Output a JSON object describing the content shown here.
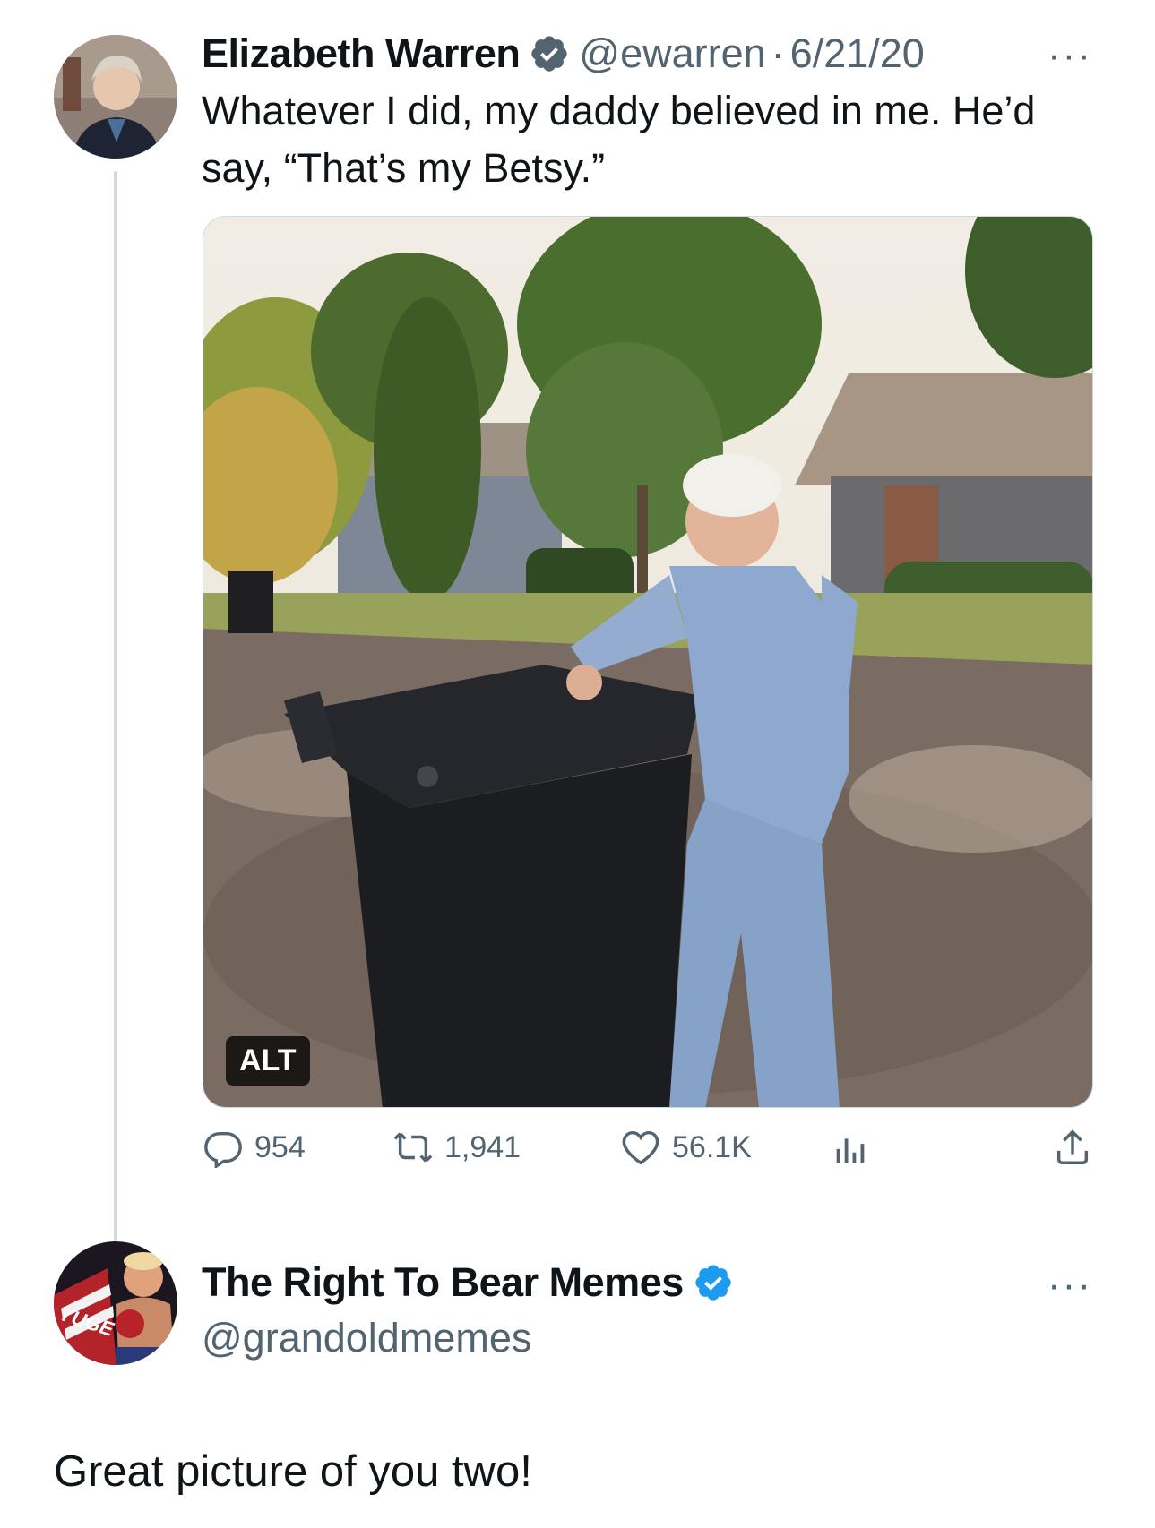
{
  "tweet": {
    "author_name": "Elizabeth Warren",
    "handle": "@ewarren",
    "separator": "·",
    "date": "6/21/20",
    "text": "Whatever I did, my daddy believed in me. He’d say, “That’s my Betsy.”",
    "media_alt_badge": "ALT",
    "stats": {
      "replies": "954",
      "reposts": "1,941",
      "likes": "56.1K"
    },
    "more_label": "···"
  },
  "reply": {
    "author_name": "The Right To Bear Memes",
    "handle": "@grandoldmemes",
    "avatar_text": "YUGE",
    "text": "Great picture of you two!",
    "more_label": "···"
  },
  "colors": {
    "verified": "#1d9bf0",
    "muted": "#536471",
    "text": "#0f1419",
    "thread_line": "#cfd9de"
  }
}
